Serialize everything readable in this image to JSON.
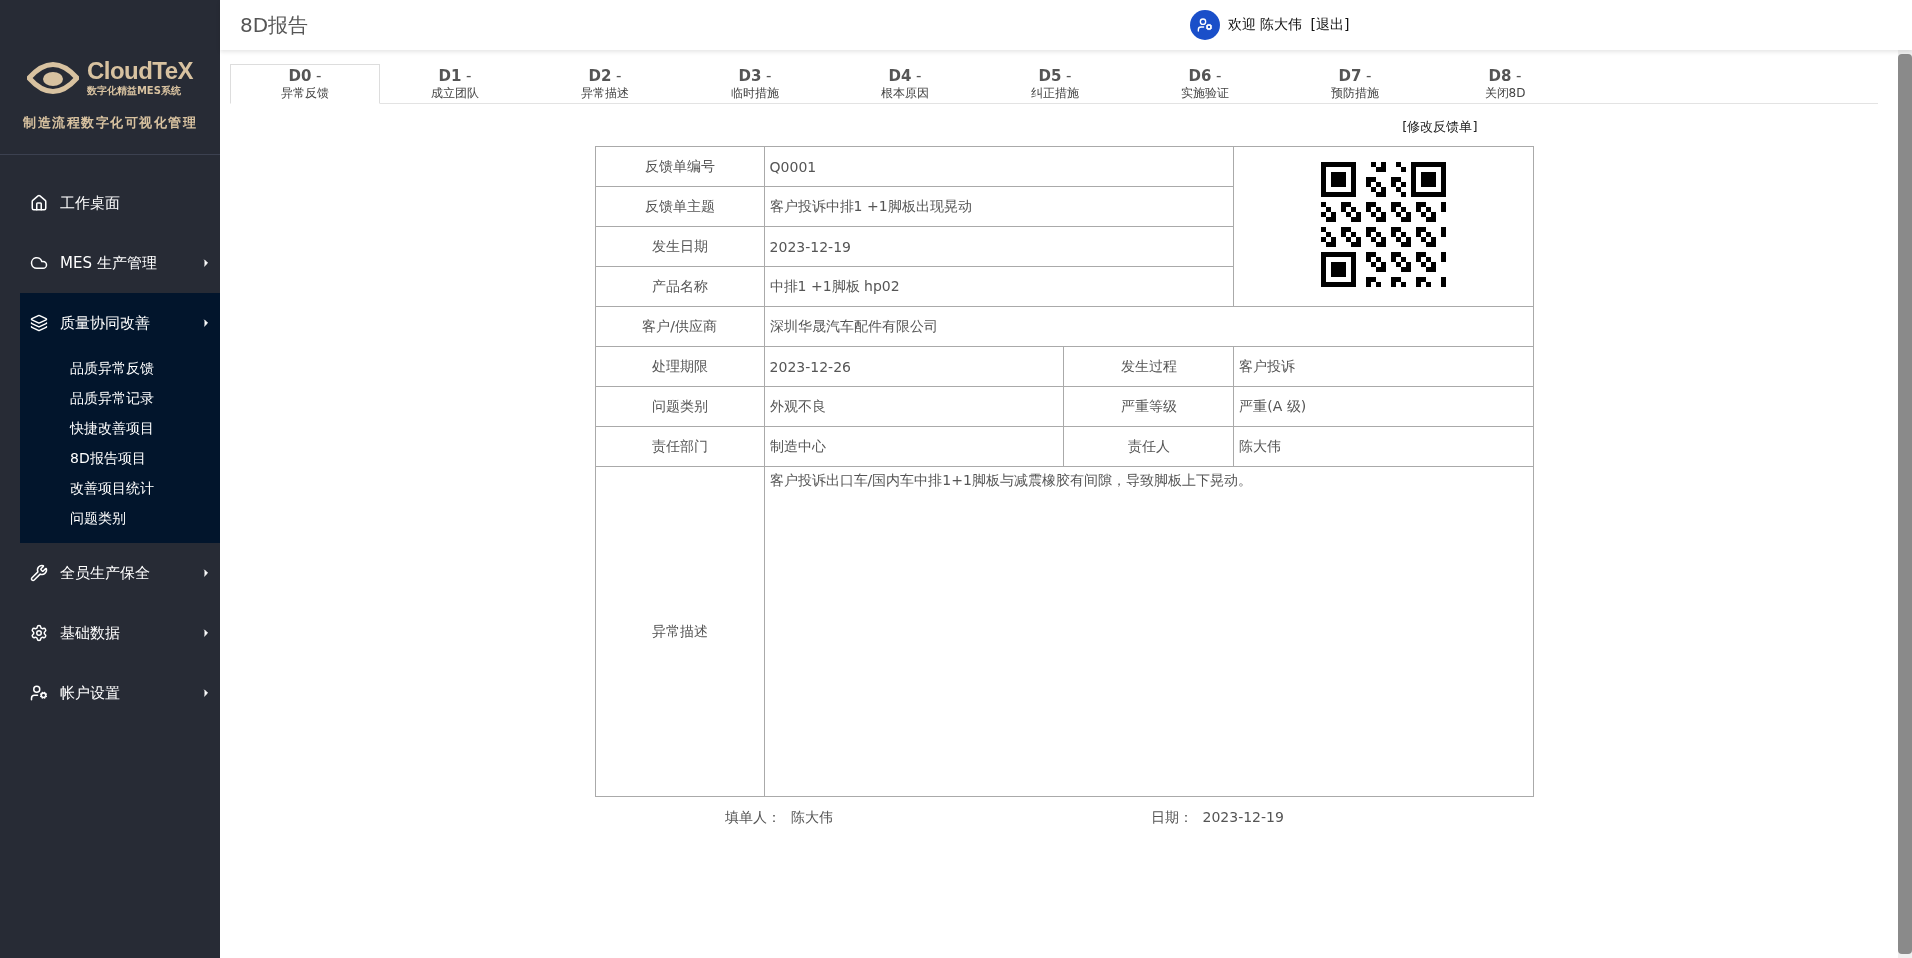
{
  "sidebar": {
    "logo": {
      "name": "CloudTeX",
      "subtitle": "数字化精益MES系统"
    },
    "slogan": "制造流程数字化可视化管理",
    "items": [
      {
        "label": "工作桌面"
      },
      {
        "label": "MES 生产管理",
        "expanded": false
      },
      {
        "label": "质量协同改善",
        "expanded": true,
        "children": [
          {
            "label": "品质异常反馈"
          },
          {
            "label": "品质异常记录"
          },
          {
            "label": "快捷改善项目"
          },
          {
            "label": "8D报告项目"
          },
          {
            "label": "改善项目统计"
          },
          {
            "label": "问题类别"
          }
        ]
      },
      {
        "label": "全员生产保全",
        "expanded": false
      },
      {
        "label": "基础数据",
        "expanded": false
      },
      {
        "label": "帐户设置",
        "expanded": false
      }
    ]
  },
  "header": {
    "title": "8D报告",
    "greeting": "欢迎 陈大伟",
    "logout": "[退出]"
  },
  "tabs": [
    {
      "code": "**D0** -",
      "label": "异常反馈",
      "selected": true
    },
    {
      "code": "**D1** -",
      "label": "成立团队",
      "selected": false
    },
    {
      "code": "**D2** -",
      "label": "异常描述",
      "selected": false
    },
    {
      "code": "**D3** -",
      "label": "临时措施",
      "selected": false
    },
    {
      "code": "**D4** -",
      "label": "根本原因",
      "selected": false
    },
    {
      "code": "**D5** -",
      "label": "纠正措施",
      "selected": false
    },
    {
      "code": "**D6** -",
      "label": "实施验证",
      "selected": false
    },
    {
      "code": "**D7** -",
      "label": "预防措施",
      "selected": false
    },
    {
      "code": "**D8** -",
      "label": "关闭8D",
      "selected": false
    }
  ],
  "edit_link": "[修改反馈单]",
  "form": {
    "top_rows": [
      {
        "label": "反馈单编号",
        "value": "Q0001"
      },
      {
        "label": "反馈单主题",
        "value": "客户投诉中排1 +1脚板出现晃动"
      },
      {
        "label": "发生日期",
        "value": "2023-12-19"
      },
      {
        "label": "产品名称",
        "value": "中排1 +1脚板 hp02"
      }
    ],
    "customer": {
      "label": "客户/供应商",
      "value": "深圳华晟汽车配件有限公司"
    },
    "pair_rows": [
      {
        "label": "处理期限",
        "value": "2023-12-26",
        "label_2": "发生过程",
        "value_2": "客户投诉"
      },
      {
        "label": "问题类别",
        "value": "外观不良",
        "label_2": "严重等级",
        "value_2": "严重(A 级)"
      },
      {
        "label": "责任部门",
        "value": "制造中心",
        "label_2": "责任人",
        "value_2": "陈大伟"
      }
    ],
    "description": {
      "label": "异常描述",
      "value": "客户投诉出口车/国内车中排1+1脚板与减震橡胶有间隙，导致脚板上下晃动。"
    }
  },
  "footer": {
    "filler_label": "填单人：",
    "filler": "陈大伟",
    "date_label": "日期：",
    "date": "2023-12-19"
  }
}
